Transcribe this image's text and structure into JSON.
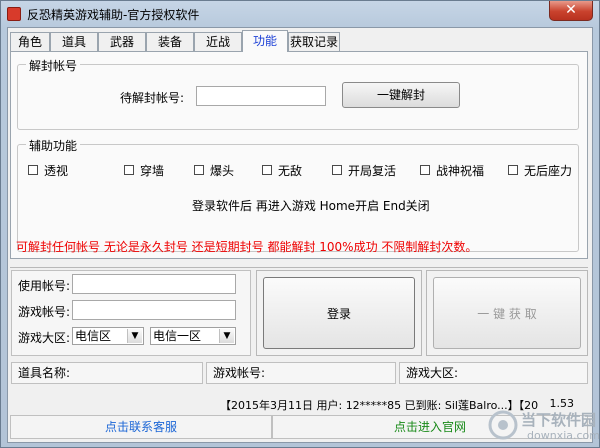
{
  "window": {
    "title": "反恐精英游戏辅助-官方授权软件",
    "close_glyph": "✕"
  },
  "tabs": [
    "角色",
    "道具",
    "武器",
    "装备",
    "近战",
    "功能",
    "获取记录"
  ],
  "unseal": {
    "legend": "解封帐号",
    "account_label": "待解封帐号:",
    "account_value": "",
    "button": "一键解封"
  },
  "assist": {
    "legend": "辅助功能",
    "options": [
      "透视",
      "穿墙",
      "爆头",
      "无敌",
      "开局复活",
      "战神祝福",
      "无后座力"
    ],
    "hint": "登录软件后 再进入游戏  Home开启  End关闭"
  },
  "notice": "可解封任何帐号 无论是永久封号 还是短期封号 都能解封 100%成功 不限制解封次数。",
  "login": {
    "use_account_label": "使用帐号:",
    "game_account_label": "游戏帐号:",
    "region_label": "游戏大区:",
    "region_primary": "电信区",
    "region_secondary": "电信一区",
    "login_button": "登录",
    "fetch_button": "一 键 获 取"
  },
  "info": {
    "item_name_label": "道具名称:",
    "game_account_label": "游戏帐号:",
    "game_region_label": "游戏大区:"
  },
  "status": {
    "text": "【2015年3月11日  用户: 12*****85  已到账: Sil莲Balro...】【20",
    "version": "1.53"
  },
  "footer": {
    "contact": "点击联系客服",
    "official": "点击进入官网"
  },
  "watermark": {
    "text": "当下软件园",
    "domain": "downxia.com"
  },
  "colors": {
    "tab_active": "#1b3fd6",
    "notice": "#e00000",
    "footer_link": "#1b66d6",
    "footer_link2": "#188a18"
  }
}
